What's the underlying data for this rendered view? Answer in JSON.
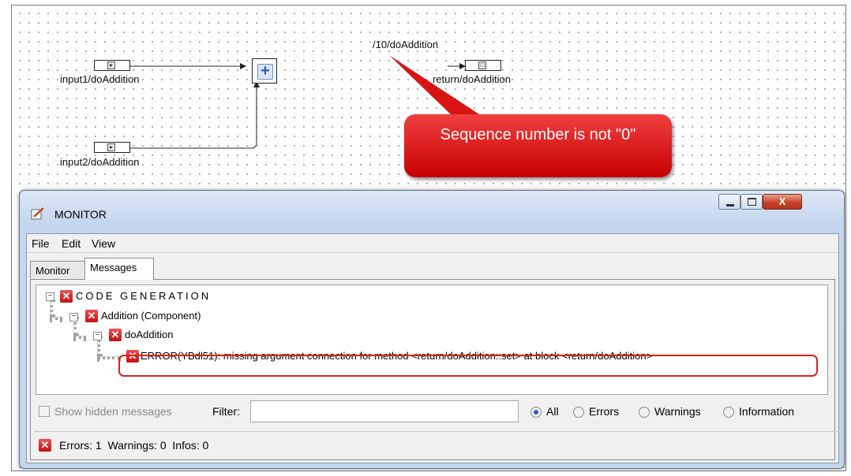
{
  "diagram": {
    "blocks": {
      "input1": "input1/doAddition",
      "input2": "input2/doAddition",
      "return": "return/doAddition",
      "sequence": "/10/doAddition"
    },
    "callout_text": "Sequence number is not \"0\""
  },
  "window": {
    "title": "MONITOR",
    "menu": [
      "File",
      "Edit",
      "View"
    ],
    "tabs": [
      "Monitor",
      "Messages"
    ],
    "active_tab": "Messages",
    "close_glyph": "X"
  },
  "tree": {
    "root": "CODE GENERATION",
    "component": "Addition (Component)",
    "method": "doAddition",
    "error": "ERROR(YBdl51): missing argument connection for method <return/doAddition::set> at block <return/doAddition>"
  },
  "filter": {
    "show_hidden_label": "Show hidden messages",
    "show_hidden_checked": false,
    "filter_label": "Filter:",
    "filter_value": "",
    "radios": [
      "All",
      "Errors",
      "Warnings",
      "Information"
    ],
    "selected": "All"
  },
  "status": {
    "text": "Errors: 1  Warnings: 0  Infos: 0"
  },
  "colors": {
    "error": "#d01818",
    "callout": "#e02020",
    "title_bar": "#c9daef"
  }
}
